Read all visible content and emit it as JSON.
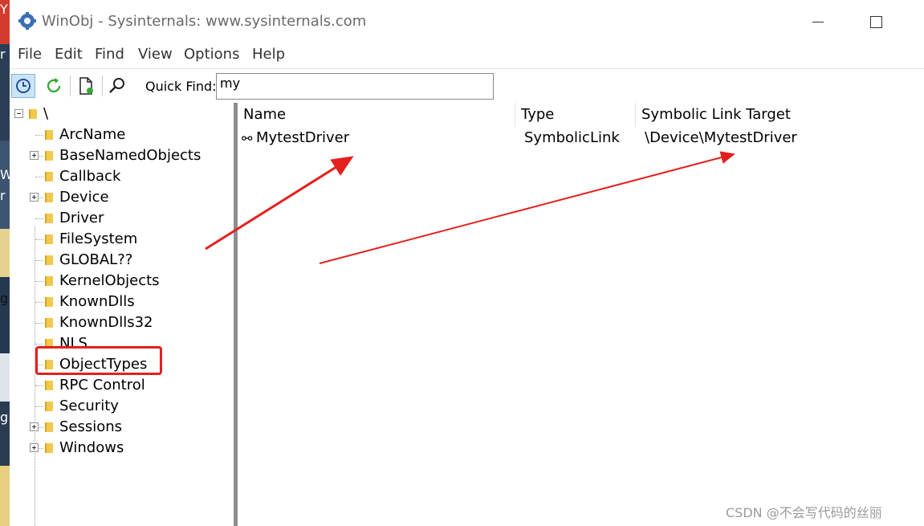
{
  "window": {
    "title": "WinObj - Sysinternals: www.sysinternals.com",
    "app_icon": "winobj-gear-icon"
  },
  "desktop": {
    "glyphs": [
      "Y",
      "r",
      "W",
      "r",
      "g",
      "g"
    ]
  },
  "menu": [
    "File",
    "Edit",
    "Find",
    "View",
    "Options",
    "Help"
  ],
  "toolbar": {
    "buttons": [
      "auto-refresh-icon",
      "refresh-icon",
      "properties-icon",
      "find-icon"
    ],
    "quick_find_label": "Quick Find:",
    "quick_find_value": "my"
  },
  "tree": {
    "root": "\\",
    "items": [
      {
        "label": "ArcName",
        "expandable": false
      },
      {
        "label": "BaseNamedObjects",
        "expandable": true
      },
      {
        "label": "Callback",
        "expandable": false
      },
      {
        "label": "Device",
        "expandable": true
      },
      {
        "label": "Driver",
        "expandable": false
      },
      {
        "label": "FileSystem",
        "expandable": false
      },
      {
        "label": "GLOBAL??",
        "expandable": false,
        "selected": true
      },
      {
        "label": "KernelObjects",
        "expandable": false
      },
      {
        "label": "KnownDlls",
        "expandable": false
      },
      {
        "label": "KnownDlls32",
        "expandable": false
      },
      {
        "label": "NLS",
        "expandable": false
      },
      {
        "label": "ObjectTypes",
        "expandable": false
      },
      {
        "label": "RPC Control",
        "expandable": false
      },
      {
        "label": "Security",
        "expandable": false
      },
      {
        "label": "Sessions",
        "expandable": true
      },
      {
        "label": "Windows",
        "expandable": true
      }
    ]
  },
  "list": {
    "columns": [
      "Name",
      "Type",
      "Symbolic Link Target"
    ],
    "rows": [
      {
        "icon": "symbolic-link-icon",
        "name": "MytestDriver",
        "type": "SymbolicLink",
        "target": "\\Device\\MytestDriver"
      }
    ]
  },
  "annotation": {
    "highlight_color": "#e4201d"
  },
  "watermark": "CSDN @不会写代码的丝丽"
}
